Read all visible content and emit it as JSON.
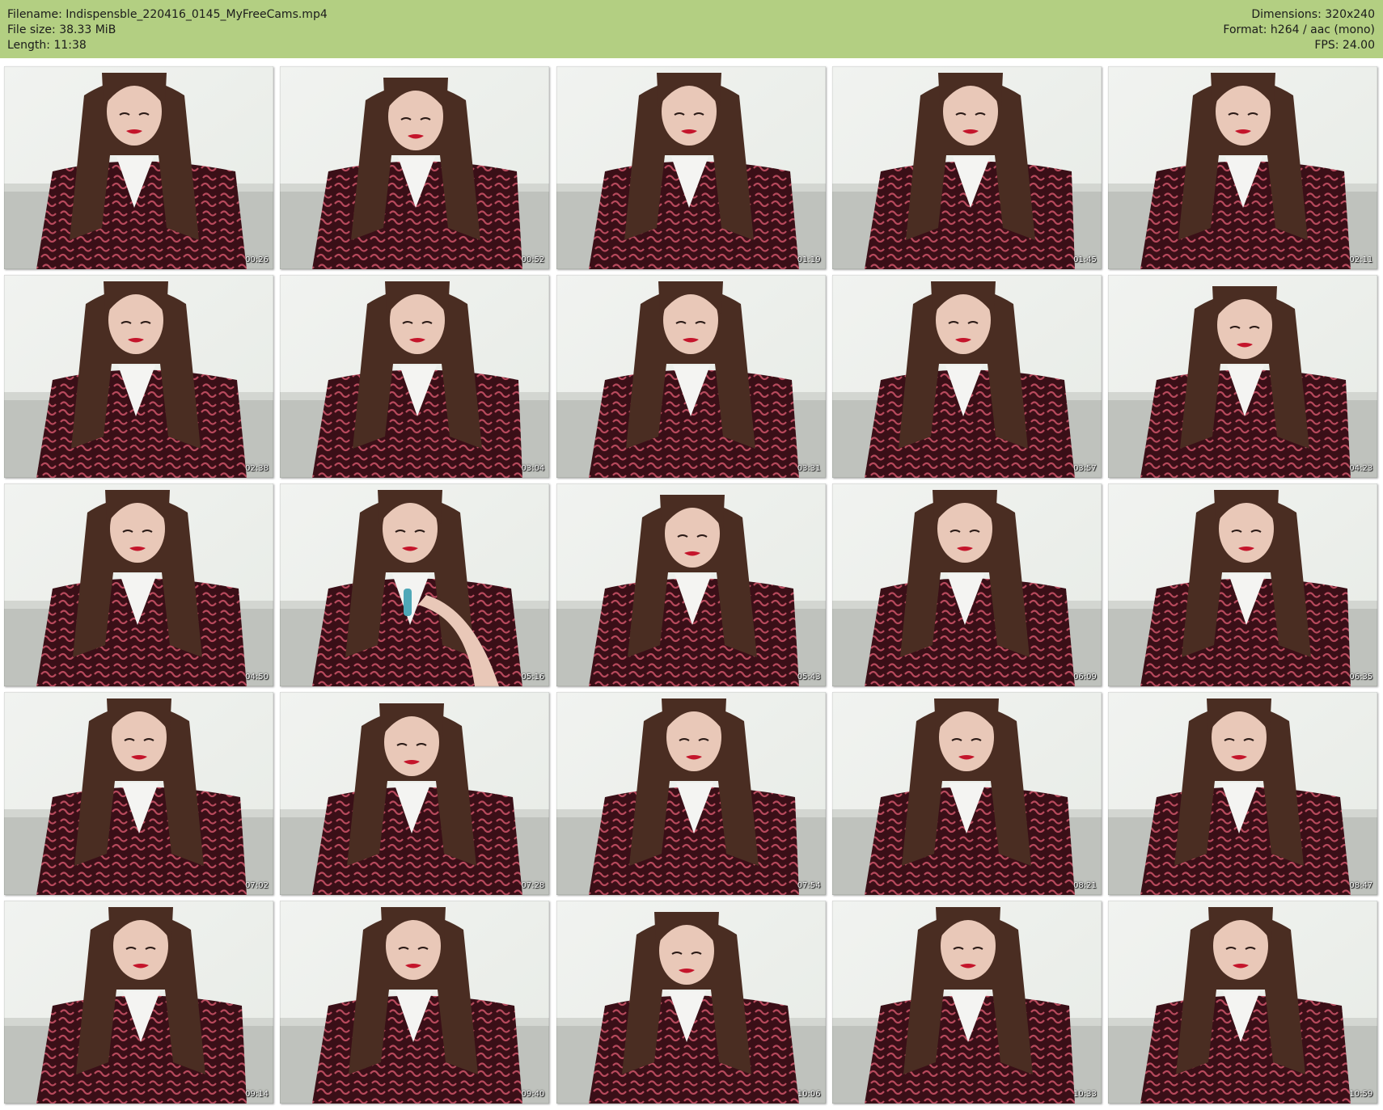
{
  "header": {
    "filename_label": "Filename: Indispensble_220416_0145_MyFreeCams.mp4",
    "filesize_label": "File size: 38.33 MiB",
    "length_label": "Length: 11:38",
    "dimensions_label": "Dimensions: 320x240",
    "format_label": "Format: h264 / aac (mono)",
    "fps_label": "FPS: 24.00"
  },
  "colors": {
    "header_bg": "#b3cf82",
    "wall": "#e7ebe6",
    "sofa": "#bfc2bd",
    "hair": "#4a2d22",
    "skin": "#e9c8b8",
    "dress": "#3a0f17",
    "dress_pattern": "#b84a5d",
    "collar": "#f4f4f2",
    "lips": "#c4152b"
  },
  "thumbnails": [
    {
      "time": "00:26",
      "variant": "a"
    },
    {
      "time": "00:52",
      "variant": "b"
    },
    {
      "time": "01:19",
      "variant": "a"
    },
    {
      "time": "01:45",
      "variant": "a"
    },
    {
      "time": "02:11",
      "variant": "a"
    },
    {
      "time": "02:38",
      "variant": "a"
    },
    {
      "time": "03:04",
      "variant": "a"
    },
    {
      "time": "03:31",
      "variant": "a"
    },
    {
      "time": "03:57",
      "variant": "a"
    },
    {
      "time": "04:23",
      "variant": "b"
    },
    {
      "time": "04:50",
      "variant": "a"
    },
    {
      "time": "05:16",
      "variant": "hand"
    },
    {
      "time": "05:43",
      "variant": "b"
    },
    {
      "time": "06:09",
      "variant": "a"
    },
    {
      "time": "06:35",
      "variant": "a"
    },
    {
      "time": "07:02",
      "variant": "a"
    },
    {
      "time": "07:28",
      "variant": "b"
    },
    {
      "time": "07:54",
      "variant": "a"
    },
    {
      "time": "08:21",
      "variant": "a"
    },
    {
      "time": "08:47",
      "variant": "a"
    },
    {
      "time": "09:14",
      "variant": "a"
    },
    {
      "time": "09:40",
      "variant": "a"
    },
    {
      "time": "10:06",
      "variant": "b"
    },
    {
      "time": "10:33",
      "variant": "a"
    },
    {
      "time": "10:59",
      "variant": "a"
    }
  ]
}
